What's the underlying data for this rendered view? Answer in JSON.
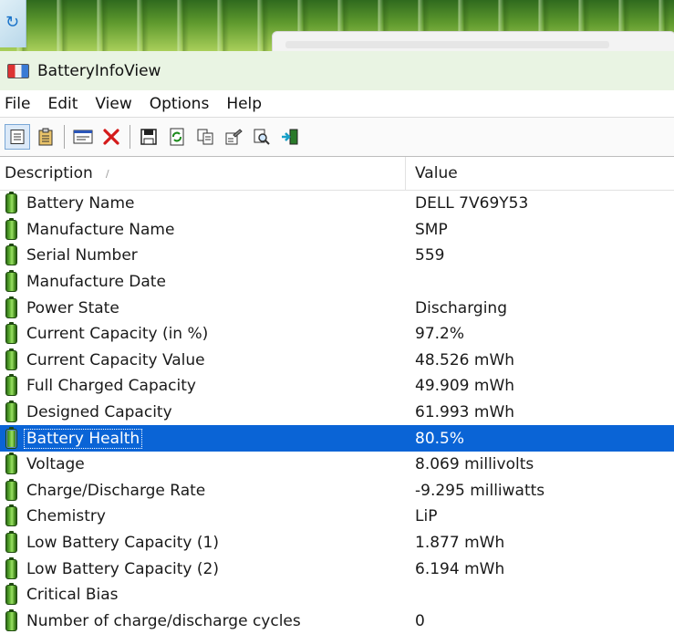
{
  "window": {
    "title": "BatteryInfoView"
  },
  "menu": [
    "File",
    "Edit",
    "View",
    "Options",
    "Help"
  ],
  "toolbar": {
    "buttons": [
      "properties-icon",
      "report-icon",
      "battery-info-icon",
      "delete-icon",
      "save-icon",
      "refresh-icon",
      "copy-icon",
      "options-icon",
      "find-icon",
      "exit-icon"
    ]
  },
  "table": {
    "columns": {
      "description": "Description",
      "value": "Value"
    },
    "rows": [
      {
        "description": "Battery Name",
        "value": "DELL 7V69Y53"
      },
      {
        "description": "Manufacture Name",
        "value": "SMP"
      },
      {
        "description": "Serial Number",
        "value": "559"
      },
      {
        "description": "Manufacture Date",
        "value": ""
      },
      {
        "description": "Power State",
        "value": "Discharging"
      },
      {
        "description": "Current Capacity (in %)",
        "value": "97.2%"
      },
      {
        "description": "Current Capacity Value",
        "value": "48.526 mWh"
      },
      {
        "description": "Full Charged Capacity",
        "value": "49.909 mWh"
      },
      {
        "description": "Designed Capacity",
        "value": "61.993 mWh"
      },
      {
        "description": "Battery Health",
        "value": "80.5%"
      },
      {
        "description": "Voltage",
        "value": "8.069 millivolts"
      },
      {
        "description": "Charge/Discharge Rate",
        "value": "-9.295 milliwatts"
      },
      {
        "description": "Chemistry",
        "value": "LiP"
      },
      {
        "description": "Low Battery Capacity (1)",
        "value": "1.877 mWh"
      },
      {
        "description": "Low Battery Capacity (2)",
        "value": "6.194 mWh"
      },
      {
        "description": "Critical Bias",
        "value": ""
      },
      {
        "description": "Number of charge/discharge cycles",
        "value": "0"
      }
    ],
    "selected_row": "Battery Health"
  },
  "colors": {
    "selection": "#0a64d6",
    "titlebar": "#e9f4e3"
  }
}
